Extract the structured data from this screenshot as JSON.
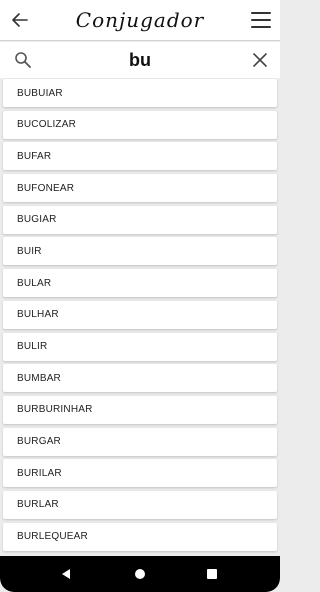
{
  "appbar": {
    "title": "Conjugador",
    "back_icon": "arrow-left-icon",
    "menu_icon": "hamburger-menu-icon"
  },
  "search": {
    "value": "bu",
    "search_icon": "search-icon",
    "clear_icon": "close-icon"
  },
  "verbs": [
    "BUBUIAR",
    "BUCOLIZAR",
    "BUFAR",
    "BUFONEAR",
    "BUGIAR",
    "BUIR",
    "BULAR",
    "BULHAR",
    "BULIR",
    "BUMBAR",
    "BURBURINHAR",
    "BURGAR",
    "BURILAR",
    "BURLAR",
    "BURLEQUEAR"
  ],
  "navbar": {
    "back_icon": "triangle-back-icon",
    "home_icon": "circle-home-icon",
    "recent_icon": "square-recents-icon"
  }
}
